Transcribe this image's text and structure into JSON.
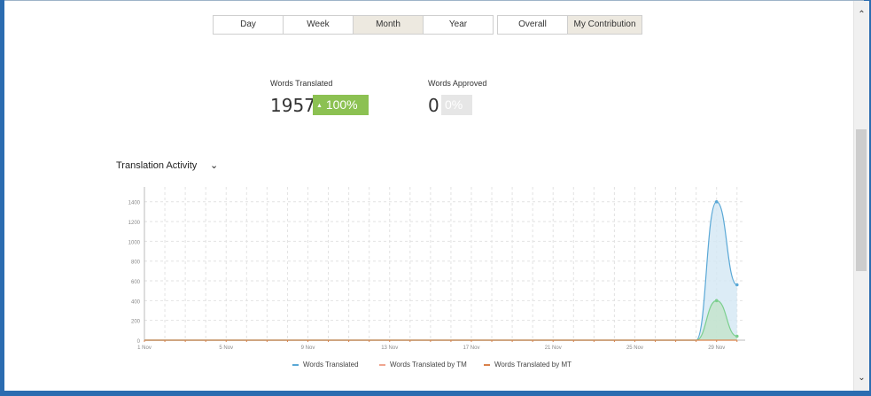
{
  "period_tabs": [
    {
      "label": "Day",
      "active": false
    },
    {
      "label": "Week",
      "active": false
    },
    {
      "label": "Month",
      "active": true
    },
    {
      "label": "Year",
      "active": false
    }
  ],
  "scope_tabs": [
    {
      "label": "Overall",
      "active": false
    },
    {
      "label": "My Contribution",
      "active": true
    }
  ],
  "stats": {
    "translated": {
      "label": "Words Translated",
      "value": "1957",
      "change": "100%",
      "change_arrow": "▲",
      "color": "#8cc152"
    },
    "approved": {
      "label": "Words Approved",
      "value": "0",
      "change": "0%",
      "color": "#e6e6e6"
    }
  },
  "section": {
    "title": "Translation Activity",
    "chevron": "⌄"
  },
  "scrollbar": {
    "up_arrow": "⌃",
    "down_arrow": "⌄"
  },
  "chart_data": {
    "type": "area",
    "x_tick_labels": [
      "1 Nov",
      "5 Nov",
      "9 Nov",
      "13 Nov",
      "17 Nov",
      "21 Nov",
      "25 Nov",
      "29 Nov"
    ],
    "x_days": [
      1,
      2,
      3,
      4,
      5,
      6,
      7,
      8,
      9,
      10,
      11,
      12,
      13,
      14,
      15,
      16,
      17,
      18,
      19,
      20,
      21,
      22,
      23,
      24,
      25,
      26,
      27,
      28,
      29,
      30
    ],
    "y_ticks": [
      0,
      200,
      400,
      600,
      800,
      1000,
      1200,
      1400
    ],
    "ylim": [
      0,
      1550
    ],
    "grid": true,
    "series": [
      {
        "name": "Words Translated",
        "color": "#5aa8d6",
        "fill": "#d3e7f4",
        "values": [
          0,
          0,
          0,
          0,
          0,
          0,
          0,
          0,
          0,
          0,
          0,
          0,
          0,
          0,
          0,
          0,
          0,
          0,
          0,
          0,
          0,
          0,
          0,
          0,
          0,
          0,
          0,
          0,
          1400,
          560
        ]
      },
      {
        "name": "Words Translated by TM",
        "color": "#f0a58f",
        "fill": "none",
        "values": [
          0,
          0,
          0,
          0,
          0,
          0,
          0,
          0,
          0,
          0,
          0,
          0,
          0,
          0,
          0,
          0,
          0,
          0,
          0,
          0,
          0,
          0,
          0,
          0,
          0,
          0,
          0,
          0,
          400,
          40
        ]
      },
      {
        "name": "Words Translated by MT",
        "color": "#d9824b",
        "fill": "none",
        "values": [
          0,
          0,
          0,
          0,
          0,
          0,
          0,
          0,
          0,
          0,
          0,
          0,
          0,
          0,
          0,
          0,
          0,
          0,
          0,
          0,
          0,
          0,
          0,
          0,
          0,
          0,
          0,
          0,
          0,
          0
        ]
      }
    ]
  }
}
